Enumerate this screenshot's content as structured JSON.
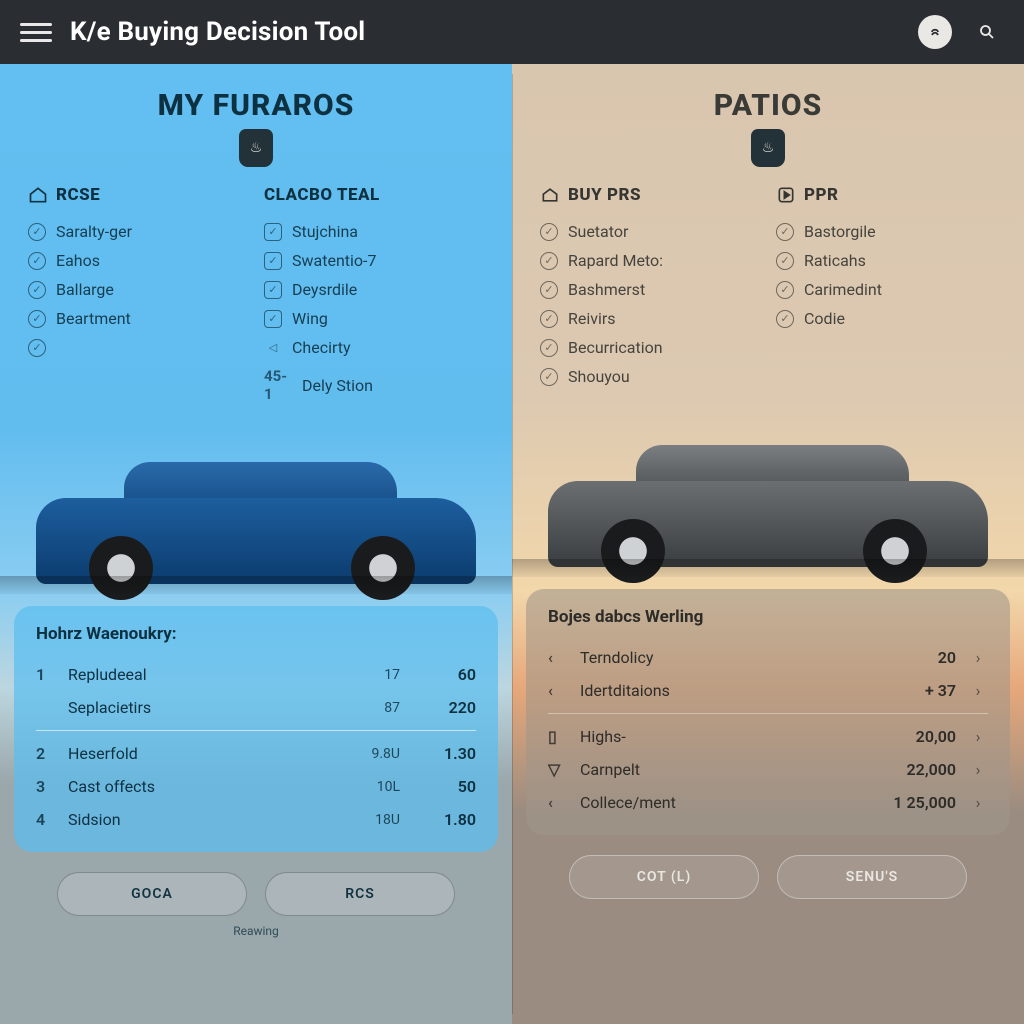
{
  "header": {
    "title": "K/e Buying Decision Tool"
  },
  "left": {
    "title": "MY FURAROS",
    "col1": {
      "head": "RCSE",
      "items": [
        "Saralty-ger",
        "Eahos",
        "Ballarge",
        "Beartment"
      ]
    },
    "col2": {
      "head": "ClACBO TEAL",
      "items": [
        "Stujchina",
        "Swatentio-7",
        "Deysrdile",
        "Wing",
        "Checirty",
        "Dely Stion"
      ],
      "last_prefix": "45-1"
    },
    "card": {
      "title": "Hohrz Waenoukry:",
      "rows": [
        {
          "idx": "1",
          "label": "Repludeeal",
          "v1": "17",
          "v2": "60"
        },
        {
          "idx": "",
          "label": "Seplacietirs",
          "v1": "87",
          "v2": "220"
        }
      ],
      "rows2": [
        {
          "idx": "2",
          "label": "Heserfold",
          "v1": "9.8U",
          "v2": "1.30"
        },
        {
          "idx": "3",
          "label": "Cast offects",
          "v1": "10L",
          "v2": "50"
        },
        {
          "idx": "4",
          "label": "Sidsion",
          "v1": "18U",
          "v2": "1.80"
        }
      ]
    },
    "buttons": [
      "GOCA",
      "RCS"
    ],
    "footnote": "Reawing"
  },
  "right": {
    "title": "PATIOS",
    "col1": {
      "head": "BUY PRS",
      "items": [
        "Suetator",
        "Rapard Meto:",
        "Bashmerst",
        "Reivirs",
        "Becurrication",
        "Shouyou"
      ]
    },
    "col2": {
      "head": "PPR",
      "items": [
        "Bastorgile",
        "Raticahs",
        "Carimedint",
        "Codie"
      ]
    },
    "card": {
      "title": "Bojes dabcs Werling",
      "rows": [
        {
          "icon": "‹",
          "label": "Terndolicy",
          "v2": "20",
          "chev": "›"
        },
        {
          "icon": "‹",
          "label": "Idertditaions",
          "v2": "+ 37",
          "chev": "›"
        }
      ],
      "rows2": [
        {
          "icon": "▯",
          "label": "Highs-",
          "v2": "20,00",
          "chev": "›"
        },
        {
          "icon": "▽",
          "label": "Carnpelt",
          "v2": "22,000",
          "chev": "›"
        },
        {
          "icon": "‹",
          "label": "Collece/ment",
          "v2": "1 25,000",
          "chev": "›"
        }
      ]
    },
    "buttons": [
      "COT (L)",
      "SENU'S"
    ]
  }
}
